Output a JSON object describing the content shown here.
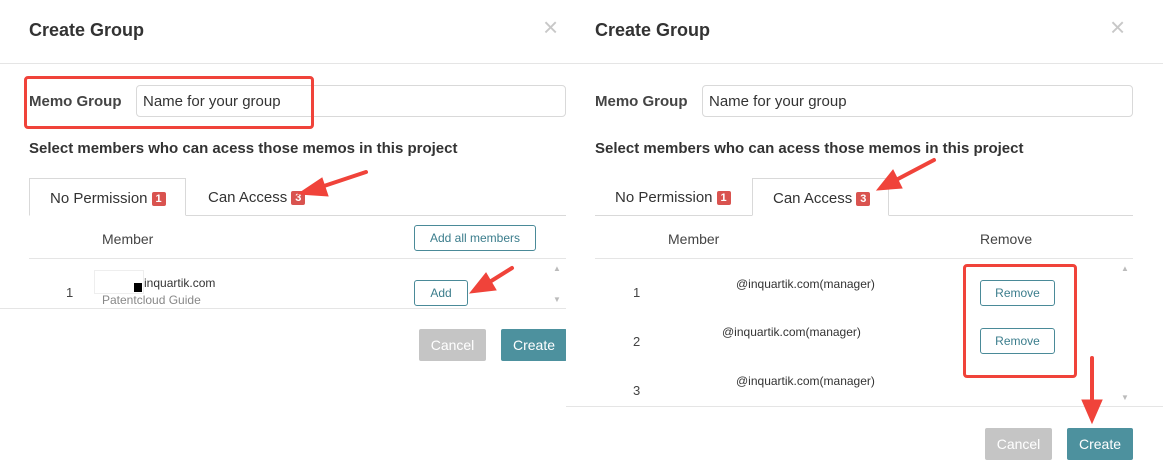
{
  "left": {
    "title": "Create Group",
    "close_icon": "×",
    "field_label": "Memo Group",
    "field_placeholder": "Name for your group",
    "instructions": "Select members who can acess those memos in this project",
    "tabs": [
      {
        "label": "No Permission",
        "badge": "1",
        "active": true
      },
      {
        "label": "Can Access",
        "badge": "3",
        "active": false
      }
    ],
    "column_member": "Member",
    "add_all_label": "Add all members",
    "rows": [
      {
        "num": "1",
        "email": "inquartik.com",
        "sub": "Patentcloud Guide",
        "action": "Add"
      }
    ],
    "cancel_label": "Cancel",
    "create_label": "Create"
  },
  "right": {
    "title": "Create Group",
    "close_icon": "×",
    "field_label": "Memo Group",
    "field_placeholder": "Name for your group",
    "instructions": "Select members who can acess those memos in this project",
    "tabs": [
      {
        "label": "No Permission",
        "badge": "1",
        "active": false
      },
      {
        "label": "Can Access",
        "badge": "3",
        "active": true
      }
    ],
    "column_member": "Member",
    "column_remove": "Remove",
    "rows": [
      {
        "num": "1",
        "email": "@inquartik.com(manager)",
        "action": "Remove"
      },
      {
        "num": "2",
        "email": "@inquartik.com(manager)",
        "action": "Remove"
      },
      {
        "num": "3",
        "email": "@inquartik.com(manager)",
        "action": ""
      }
    ],
    "cancel_label": "Cancel",
    "create_label": "Create"
  },
  "annotation_color": "#f0433a",
  "icons": {
    "close": "close-icon",
    "scroll_up": "scroll-up-icon",
    "scroll_down": "scroll-down-icon"
  }
}
